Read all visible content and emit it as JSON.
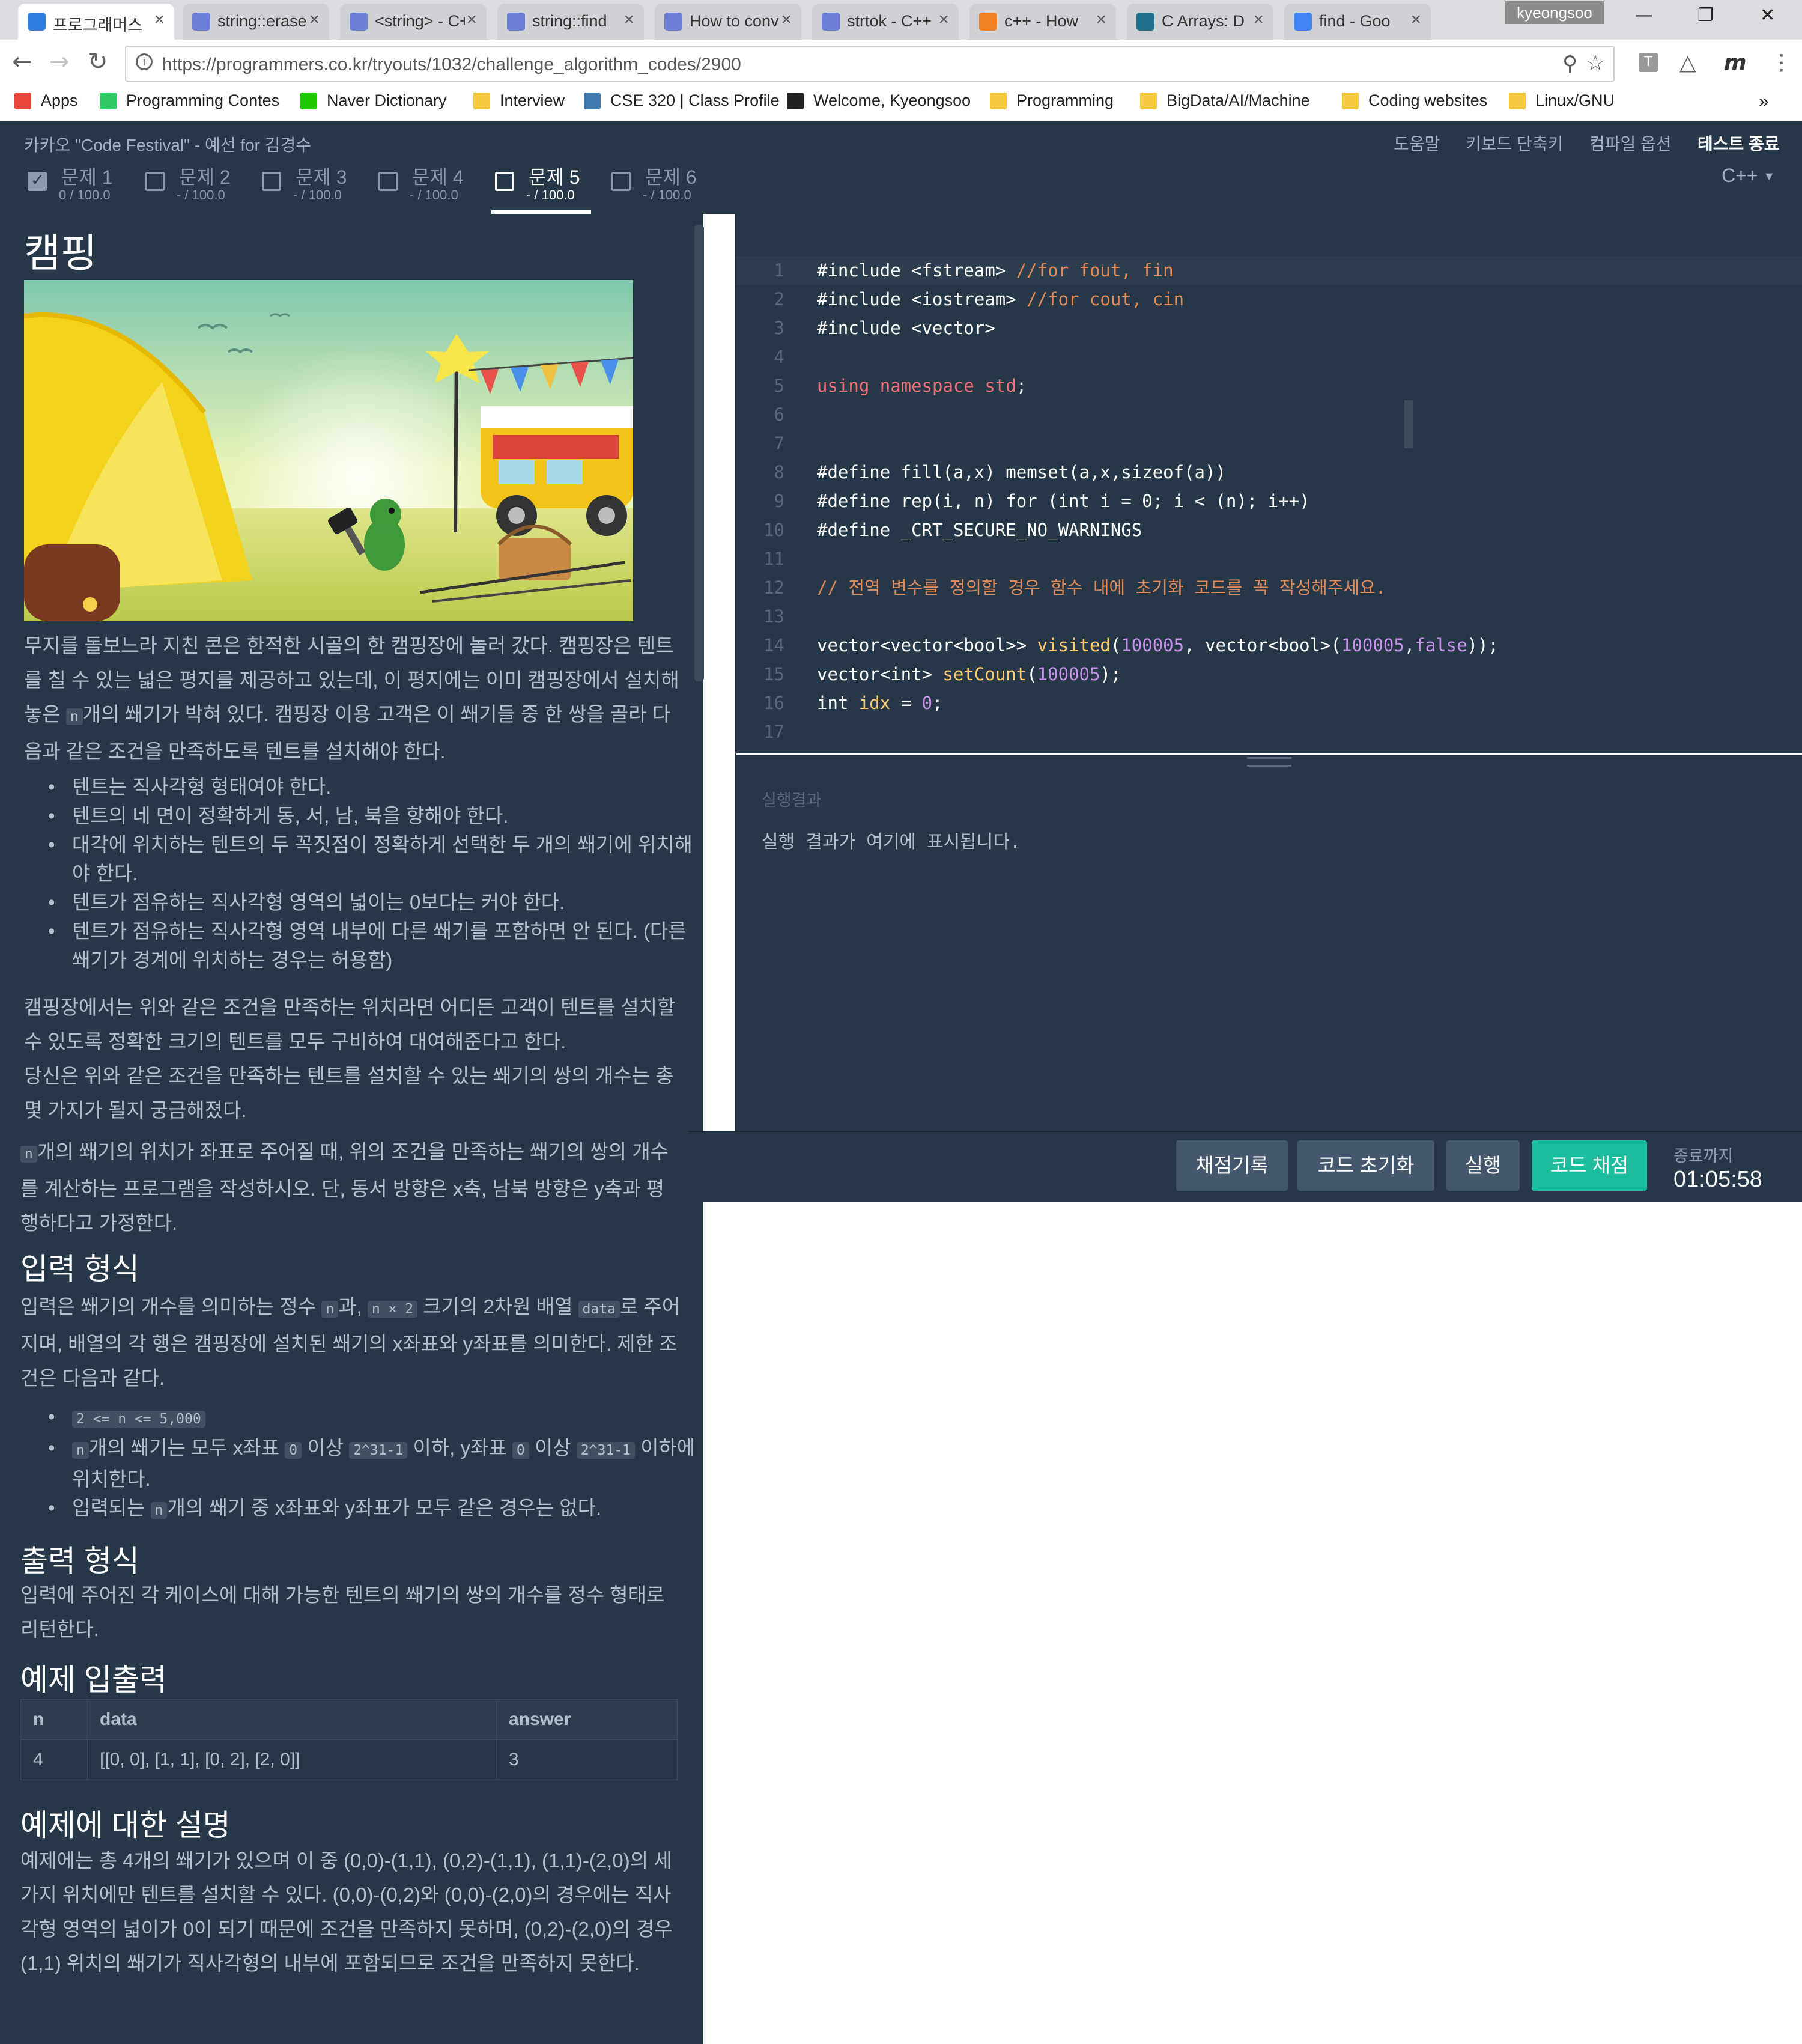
{
  "browser": {
    "tabs": [
      {
        "title": "프로그래머스",
        "favicon_color": "#2f7de1",
        "active": true
      },
      {
        "title": "string::erase",
        "favicon_color": "#6b7fd6",
        "active": false
      },
      {
        "title": "<string> - C++",
        "favicon_color": "#6b7fd6",
        "active": false
      },
      {
        "title": "string::find",
        "favicon_color": "#6b7fd6",
        "active": false
      },
      {
        "title": "How to conv",
        "favicon_color": "#6b7fd6",
        "active": false
      },
      {
        "title": "strtok - C++",
        "favicon_color": "#6b7fd6",
        "active": false
      },
      {
        "title": "c++ - How",
        "favicon_color": "#f48024",
        "active": false
      },
      {
        "title": "C Arrays: D",
        "favicon_color": "#1d6f8c",
        "active": false
      },
      {
        "title": "find - Goo",
        "favicon_color": "#4285f4",
        "active": false
      }
    ],
    "profile_name": "kyeongsoo",
    "window_controls": {
      "minimize": "—",
      "restore": "❐",
      "close": "✕"
    },
    "url": "https://programmers.co.kr/tryouts/1032/challenge_algorithm_codes/2900",
    "bookmarks": [
      {
        "label": "Apps",
        "icon": "apps-grid-icon"
      },
      {
        "label": "Programming Contes",
        "icon": "hackerrank-icon"
      },
      {
        "label": "Naver Dictionary",
        "icon": "naver-dict-icon"
      },
      {
        "label": "Interview",
        "icon": "folder-icon"
      },
      {
        "label": "CSE 320 | Class Profile",
        "icon": "piazza-icon"
      },
      {
        "label": "Welcome, Kyeongsoo",
        "icon": "blackboard-icon"
      },
      {
        "label": "Programming",
        "icon": "folder-icon"
      },
      {
        "label": "BigData/AI/Machine",
        "icon": "folder-icon"
      },
      {
        "label": "Coding websites",
        "icon": "folder-icon"
      },
      {
        "label": "Linux/GNU",
        "icon": "folder-icon"
      }
    ],
    "bookmarks_overflow": "»"
  },
  "header": {
    "title": "카카오 \"Code Festival\" - 예선 for 김경수",
    "links": [
      "도움말",
      "키보드 단축키",
      "컴파일 옵션",
      "테스트 종료"
    ],
    "language": "C++",
    "problems": [
      {
        "label": "문제 1",
        "score": "0 / 100.0",
        "checked": true,
        "active": false
      },
      {
        "label": "문제 2",
        "score": "- / 100.0",
        "checked": false,
        "active": false
      },
      {
        "label": "문제 3",
        "score": "- / 100.0",
        "checked": false,
        "active": false
      },
      {
        "label": "문제 4",
        "score": "- / 100.0",
        "checked": false,
        "active": false
      },
      {
        "label": "문제 5",
        "score": "- / 100.0",
        "checked": false,
        "active": true
      },
      {
        "label": "문제 6",
        "score": "- / 100.0",
        "checked": false,
        "active": false
      }
    ]
  },
  "problem": {
    "title": "캠핑",
    "intro": [
      "무지를 돌보느라 지친 콘은 한적한 시골의 한 캠핑장에 놀러 갔다. 캠핑장은 텐트를 칠 수 있는 넓은 평지를 제공하고 있는데, 이 평지에는 이미 캠핑장에서 설치해 놓은 ",
      "n",
      "개의 쐐기가 박혀 있다. 캠핑장 이용 고객은 이 쐐기들 중 한 쌍을 골라 다음과 같은 조건을 만족하도록 텐트를 설치해야 한다."
    ],
    "conditions": [
      "텐트는 직사각형 형태여야 한다.",
      "텐트의 네 면이 정확하게 동, 서, 남, 북을 향해야 한다.",
      "대각에 위치하는 텐트의 두 꼭짓점이 정확하게 선택한 두 개의 쐐기에 위치해야 한다.",
      "텐트가 점유하는 직사각형 영역의 넓이는 0보다는 커야 한다.",
      "텐트가 점유하는 직사각형 영역 내부에 다른 쐐기를 포함하면 안 된다. (다른 쐐기가 경계에 위치하는 경우는 허용함)"
    ],
    "para2": "캠핑장에서는 위와 같은 조건을 만족하는 위치라면 어디든 고객이 텐트를 설치할 수 있도록 정확한 크기의 텐트를 모두 구비하여 대여해준다고 한다.",
    "para3": "당신은 위와 같은 조건을 만족하는 텐트를 설치할 수 있는 쐐기의 쌍의 개수는 총 몇 가지가 될지 궁금해졌다.",
    "para4": [
      "n",
      "개의 쐐기의 위치가 좌표로 주어질 때, 위의 조건을 만족하는 쐐기의 쌍의 개수를 계산하는 프로그램을 작성하시오. 단, 동서 방향은 x축, 남북 방향은 y축과 평행하다고 가정한다."
    ],
    "input_heading": "입력 형식",
    "input_desc": [
      "입력은 쐐기의 개수를 의미하는 정수 ",
      "n",
      "과, ",
      "n × 2",
      " 크기의 2차원 배열 ",
      "data",
      "로 주어지며, 배열의 각 행은 캠핑장에 설치된 쐐기의 x좌표와 y좌표를 의미한다. 제한 조건은 다음과 같다."
    ],
    "input_bullets": {
      "b1": "2 <= n <= 5,000",
      "b2": [
        "n",
        "개의 쐐기는 모두 x좌표 ",
        "0",
        " 이상 ",
        "2^31-1",
        " 이하, y좌표 ",
        "0",
        " 이상 ",
        "2^31-1",
        " 이하에 위치한다."
      ],
      "b3": [
        "입력되는 ",
        "n",
        "개의 쐐기 중 x좌표와 y좌표가 모두 같은 경우는 없다."
      ]
    },
    "output_heading": "출력 형식",
    "output_desc": "입력에 주어진 각 케이스에 대해 가능한 텐트의 쐐기의 쌍의 개수를 정수 형태로 리턴한다.",
    "example_heading": "예제 입출력",
    "example_table": {
      "headers": [
        "n",
        "data",
        "answer"
      ],
      "rows": [
        [
          "4",
          "[[0, 0], [1, 1], [0, 2], [2, 0]]",
          "3"
        ]
      ]
    },
    "explain_heading": "예제에 대한 설명",
    "explain_desc": "예제에는 총 4개의 쐐기가 있으며 이 중 (0,0)-(1,1), (0,2)-(1,1), (1,1)-(2,0)의 세 가지 위치에만 텐트를 설치할 수 있다. (0,0)-(0,2)와 (0,0)-(2,0)의 경우에는 직사각형 영역의 넓이가 0이 되기 때문에 조건을 만족하지 못하며, (0,2)-(2,0)의 경우 (1,1) 위치의 쐐기가 직사각형의 내부에 포함되므로 조건을 만족하지 못한다."
  },
  "editor": {
    "lines": [
      {
        "n": "1",
        "segments": [
          [
            "",
            "#include <fstream> "
          ],
          [
            "cm",
            "//for fout, fin"
          ]
        ]
      },
      {
        "n": "2",
        "segments": [
          [
            "",
            "#include <iostream> "
          ],
          [
            "cm",
            "//for cout, cin"
          ]
        ]
      },
      {
        "n": "3",
        "segments": [
          [
            "",
            "#include <vector>"
          ]
        ]
      },
      {
        "n": "4",
        "segments": []
      },
      {
        "n": "5",
        "segments": [
          [
            "kw",
            "using namespace std"
          ],
          [
            "",
            ";"
          ]
        ]
      },
      {
        "n": "6",
        "segments": []
      },
      {
        "n": "7",
        "segments": []
      },
      {
        "n": "8",
        "segments": [
          [
            "",
            "#define fill(a,x) memset(a,x,sizeof(a))"
          ]
        ]
      },
      {
        "n": "9",
        "segments": [
          [
            "",
            "#define rep(i, n) for (int i = 0; i < (n); i++)"
          ]
        ]
      },
      {
        "n": "10",
        "segments": [
          [
            "",
            "#define _CRT_SECURE_NO_WARNINGS"
          ]
        ]
      },
      {
        "n": "11",
        "segments": []
      },
      {
        "n": "12",
        "segments": [
          [
            "cm",
            "// 전역 변수를 정의할 경우 함수 내에 초기화 코드를 꼭 작성해주세요."
          ]
        ]
      },
      {
        "n": "13",
        "segments": []
      },
      {
        "n": "14",
        "segments": [
          [
            "",
            "vector<vector<bool>> "
          ],
          [
            "fn",
            "visited"
          ],
          [
            "",
            "("
          ],
          [
            "nm",
            "100005"
          ],
          [
            "",
            ", vector<bool>("
          ],
          [
            "nm",
            "100005"
          ],
          [
            "",
            ","
          ],
          [
            "nm",
            "false"
          ],
          [
            "",
            "));"
          ]
        ]
      },
      {
        "n": "15",
        "segments": [
          [
            "",
            "vector<int> "
          ],
          [
            "fn",
            "setCount"
          ],
          [
            "",
            "("
          ],
          [
            "nm",
            "100005"
          ],
          [
            "",
            ");"
          ]
        ]
      },
      {
        "n": "16",
        "segments": [
          [
            "",
            "int "
          ],
          [
            "fn",
            "idx"
          ],
          [
            "",
            " = "
          ],
          [
            "nm",
            "0"
          ],
          [
            "",
            ";"
          ]
        ]
      },
      {
        "n": "17",
        "segments": []
      }
    ]
  },
  "result": {
    "label": "실행결과",
    "text": "실행 결과가 여기에 표시됩니다."
  },
  "actions": {
    "history": "채점기록",
    "reset": "코드 초기화",
    "run": "실행",
    "submit": "코드 채점",
    "timer_label": "종료까지",
    "timer": "01:05:58"
  }
}
